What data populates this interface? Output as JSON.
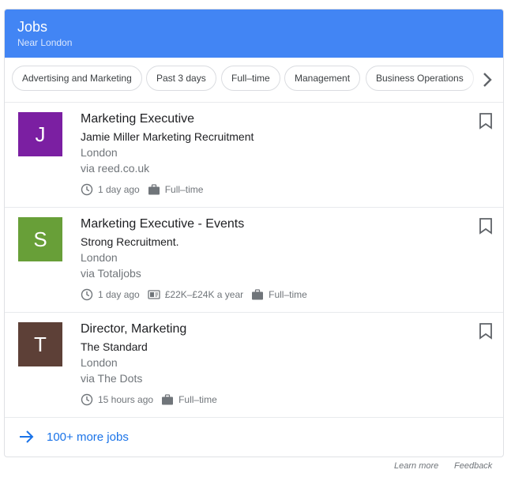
{
  "header": {
    "title": "Jobs",
    "subtitle": "Near London"
  },
  "chips": [
    "Advertising and Marketing",
    "Past 3 days",
    "Full–time",
    "Management",
    "Business Operations"
  ],
  "jobs": [
    {
      "initial": "J",
      "avatar_color": "#7b1fa2",
      "title": "Marketing Executive",
      "company": "Jamie Miller Marketing Recruitment",
      "location": "London",
      "via": "via reed.co.uk",
      "posted": "1 day ago",
      "type": "Full–time"
    },
    {
      "initial": "S",
      "avatar_color": "#689f38",
      "title": "Marketing Executive - Events",
      "company": "Strong Recruitment.",
      "location": "London",
      "via": "via Totaljobs",
      "posted": "1 day ago",
      "salary": "£22K–£24K a year",
      "type": "Full–time"
    },
    {
      "initial": "T",
      "avatar_color": "#5d4037",
      "title": "Director, Marketing",
      "company": "The Standard",
      "location": "London",
      "via": "via The Dots",
      "posted": "15 hours ago",
      "type": "Full–time"
    }
  ],
  "more_link": "100+ more jobs",
  "footer": {
    "learn_more": "Learn more",
    "feedback": "Feedback"
  },
  "colors": {
    "header_bg": "#4285f4",
    "link": "#1a73e8"
  }
}
